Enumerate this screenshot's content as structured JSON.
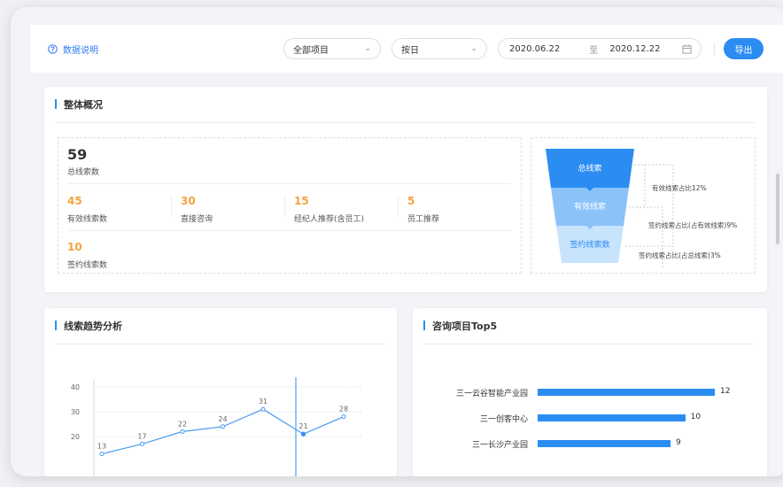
{
  "toolbar": {
    "help_label": "数据说明",
    "project_select": "全部项目",
    "period_select": "按日",
    "date_from": "2020.06.22",
    "date_sep": "至",
    "date_to": "2020.12.22",
    "export_label": "导出"
  },
  "overview": {
    "title": "整体概况",
    "total_value": "59",
    "total_label": "总线索数",
    "items": [
      {
        "value": "45",
        "label": "有效线索数"
      },
      {
        "value": "30",
        "label": "直接咨询"
      },
      {
        "value": "15",
        "label": "经纪人推荐(含员工)"
      },
      {
        "value": "5",
        "label": "员工推荐"
      }
    ],
    "signed": {
      "value": "10",
      "label": "签约线索数"
    },
    "funnel": {
      "levels": [
        "总线索",
        "有效线索",
        "签约线索数"
      ],
      "notes": [
        "有效线索占比12%",
        "签约线索占比(占有效线索)9%",
        "签约线索占比(占总线索)3%"
      ],
      "colors": [
        "#2b8cf2",
        "#8bc3f9",
        "#c8e3fc"
      ]
    }
  },
  "trend": {
    "title": "线索趋势分析",
    "chart_data": {
      "type": "line",
      "x": [
        1,
        2,
        3,
        4,
        5,
        6,
        7
      ],
      "values": [
        13,
        17,
        22,
        24,
        31,
        21,
        28
      ],
      "yticks": [
        "40",
        "30",
        "20"
      ],
      "ylim": [
        10,
        40
      ],
      "grid": true,
      "color": "#4a9bf0"
    }
  },
  "top5": {
    "title": "咨询项目Top5",
    "chart_data": {
      "type": "bar",
      "orientation": "horizontal",
      "categories": [
        "三一云谷智能产业园",
        "三一创客中心",
        "三一长沙产业园"
      ],
      "values": [
        12,
        10,
        9
      ],
      "xlim": [
        0,
        12
      ],
      "color": "#2b8cf2"
    }
  }
}
